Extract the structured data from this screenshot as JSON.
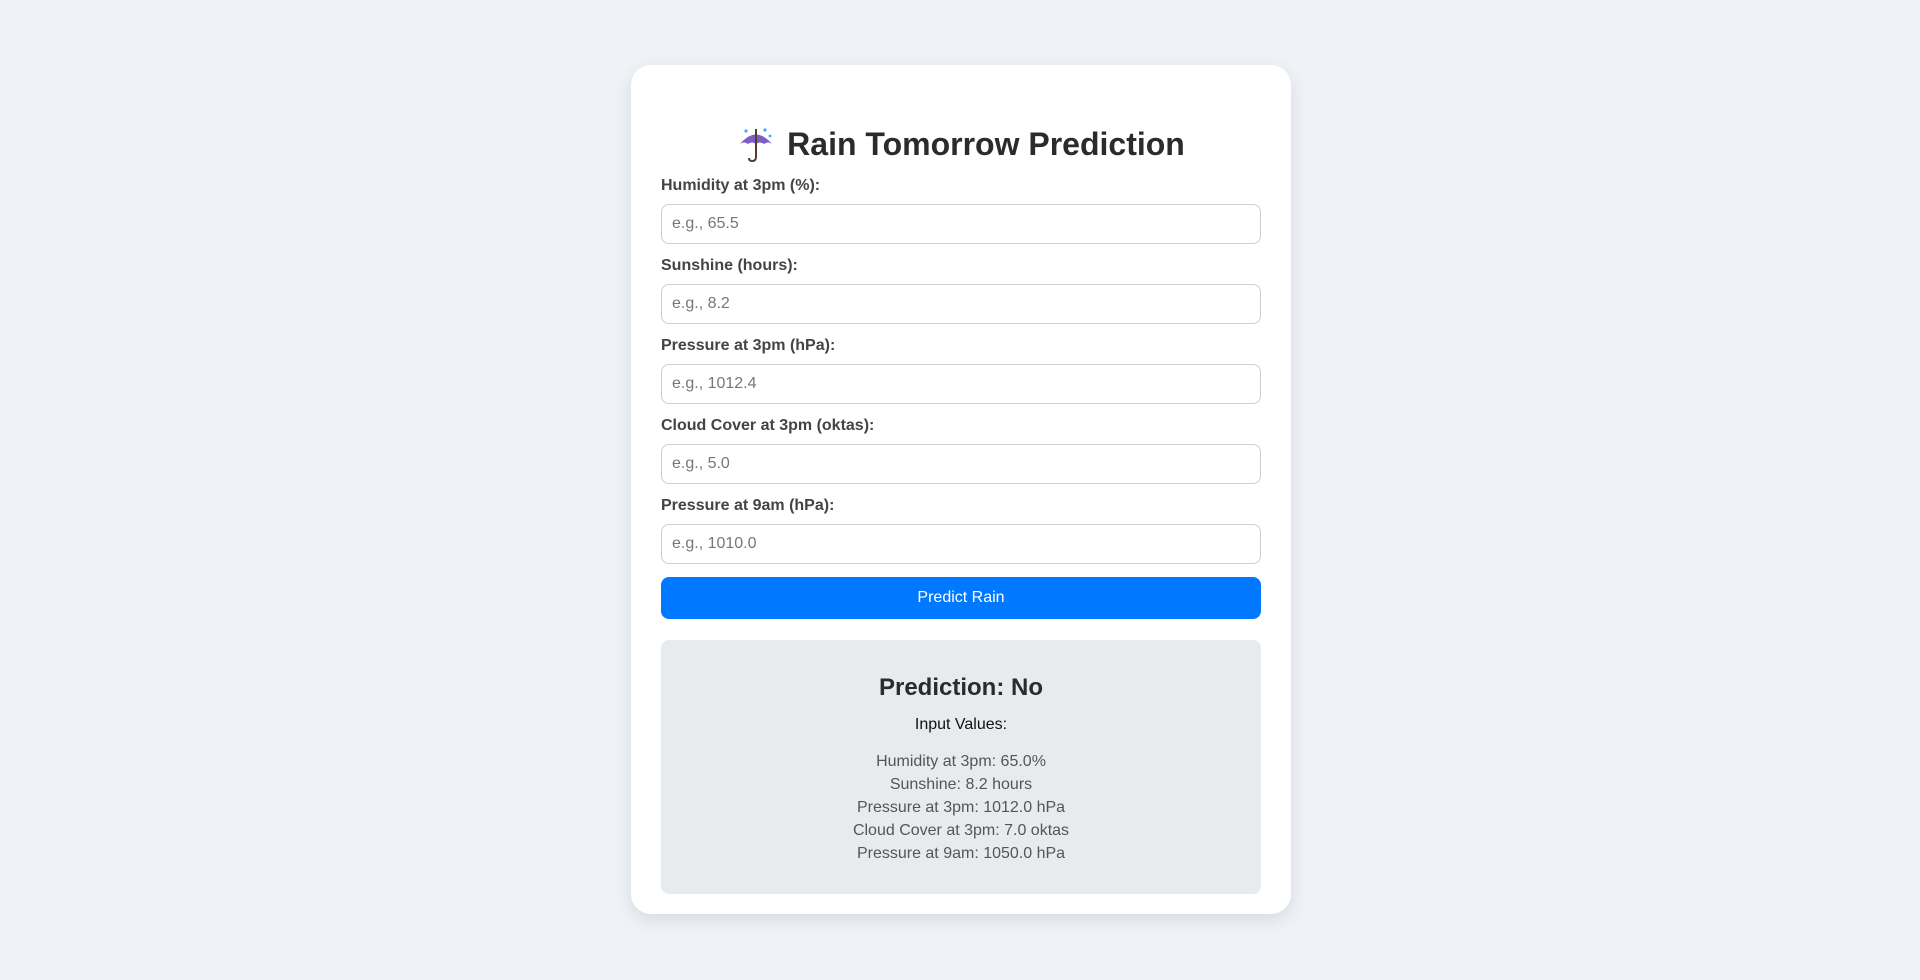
{
  "app": {
    "title": "Rain Tomorrow Prediction",
    "icon": "umbrella-with-rain-icon"
  },
  "form": {
    "fields": [
      {
        "label": "Humidity at 3pm (%):",
        "placeholder": "e.g., 65.5",
        "value": ""
      },
      {
        "label": "Sunshine (hours):",
        "placeholder": "e.g., 8.2",
        "value": ""
      },
      {
        "label": "Pressure at 3pm (hPa):",
        "placeholder": "e.g., 1012.4",
        "value": ""
      },
      {
        "label": "Cloud Cover at 3pm (oktas):",
        "placeholder": "e.g., 5.0",
        "value": ""
      },
      {
        "label": "Pressure at 9am (hPa):",
        "placeholder": "e.g., 1010.0",
        "value": ""
      }
    ],
    "submit_label": "Predict Rain"
  },
  "result": {
    "prediction": "Prediction: No",
    "input_values_heading": "Input Values:",
    "values": [
      "Humidity at 3pm: 65.0%",
      "Sunshine: 8.2 hours",
      "Pressure at 3pm: 1012.0 hPa",
      "Cloud Cover at 3pm: 7.0 oktas",
      "Pressure at 9am: 1050.0 hPa"
    ]
  },
  "colors": {
    "page_background": "#eff3f8",
    "card_background": "#ffffff",
    "button_accent": "#0078ff",
    "result_background": "#e8ebee"
  }
}
